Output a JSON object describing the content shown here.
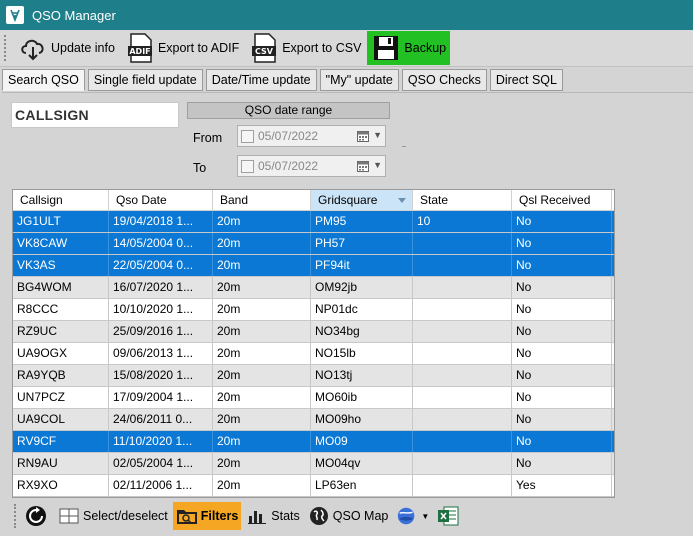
{
  "window": {
    "title": "QSO Manager"
  },
  "toolbar": {
    "update_info": "Update info",
    "export_adif": "Export to ADIF",
    "export_csv": "Export to CSV",
    "backup": "Backup",
    "adif_icon_text": "ADIF",
    "csv_icon_text": "CSV"
  },
  "tabs": [
    "Search QSO",
    "Single field update",
    "Date/Time update",
    "\"My\" update",
    "QSO Checks",
    "Direct SQL"
  ],
  "search": {
    "callsign_label": "CALLSIGN",
    "range_header": "QSO date range",
    "from_label": "From",
    "to_label": "To",
    "from_value": "05/07/2022",
    "to_value": "05/07/2022"
  },
  "grid": {
    "columns": [
      "Callsign",
      "Qso Date",
      "Band",
      "Gridsquare",
      "State",
      "Qsl Received"
    ],
    "rows": [
      [
        "JG1ULT",
        "19/04/2018 1...",
        "20m",
        "PM95",
        "10",
        "No"
      ],
      [
        "VK8CAW",
        "14/05/2004 0...",
        "20m",
        "PH57",
        "",
        "No"
      ],
      [
        "VK3AS",
        "22/05/2004 0...",
        "20m",
        "PF94it",
        "",
        "No"
      ],
      [
        "BG4WOM",
        "16/07/2020 1...",
        "20m",
        "OM92jb",
        "",
        "No"
      ],
      [
        "R8CCC",
        "10/10/2020 1...",
        "20m",
        "NP01dc",
        "",
        "No"
      ],
      [
        "RZ9UC",
        "25/09/2016 1...",
        "20m",
        "NO34bg",
        "",
        "No"
      ],
      [
        "UA9OGX",
        "09/06/2013 1...",
        "20m",
        "NO15lb",
        "",
        "No"
      ],
      [
        "RA9YQB",
        "15/08/2020 1...",
        "20m",
        "NO13tj",
        "",
        "No"
      ],
      [
        "UN7PCZ",
        "17/09/2004 1...",
        "20m",
        "MO60ib",
        "",
        "No"
      ],
      [
        "UA9COL",
        "24/06/2011 0...",
        "20m",
        "MO09ho",
        "",
        "No"
      ],
      [
        "RV9CF",
        "11/10/2020 1...",
        "20m",
        "MO09",
        "",
        "No"
      ],
      [
        "RN9AU",
        "02/05/2004 1...",
        "20m",
        "MO04qv",
        "",
        "No"
      ],
      [
        "RX9XO",
        "02/11/2006 1...",
        "20m",
        "LP63en",
        "",
        "Yes"
      ]
    ]
  },
  "bottombar": {
    "select_deselect": "Select/deselect",
    "filters": "Filters",
    "stats": "Stats",
    "qso_map": "QSO Map"
  }
}
